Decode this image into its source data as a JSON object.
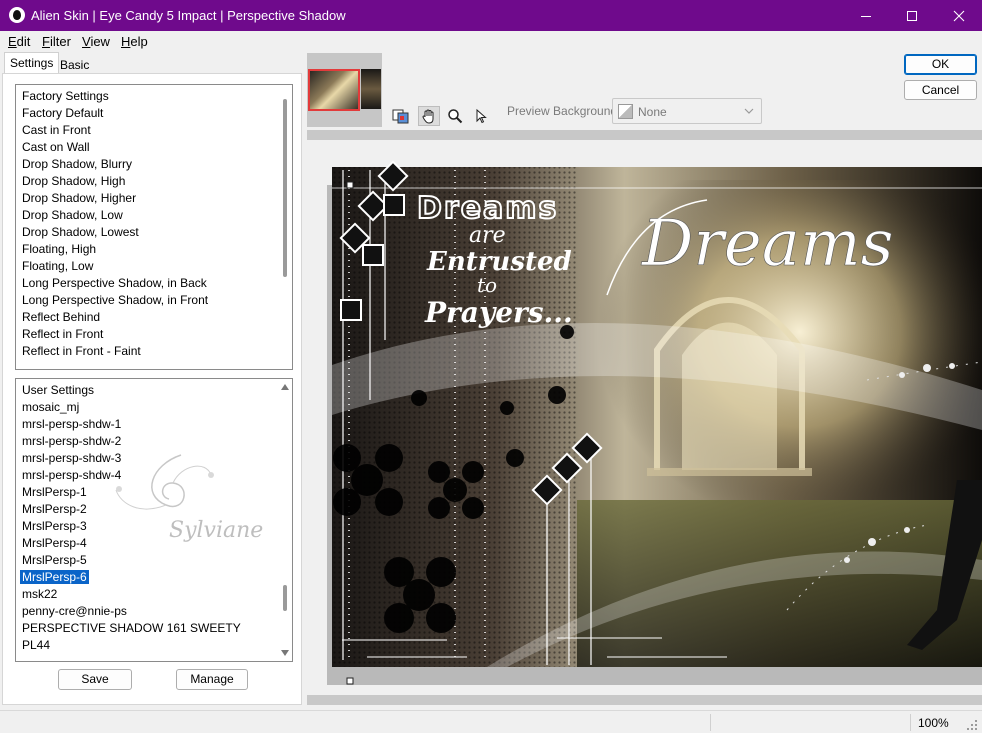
{
  "window": {
    "title": "Alien Skin | Eye Candy 5 Impact | Perspective Shadow"
  },
  "menu": {
    "items": [
      {
        "label": "Edit",
        "accel": "E",
        "rest": "dit"
      },
      {
        "label": "Filter",
        "accel": "F",
        "rest": "ilter"
      },
      {
        "label": "View",
        "accel": "V",
        "rest": "iew"
      },
      {
        "label": "Help",
        "accel": "H",
        "rest": "elp"
      }
    ]
  },
  "tabs": {
    "settings": "Settings",
    "basic": "Basic"
  },
  "factory": {
    "header": "Factory Settings",
    "items": [
      "Factory Default",
      "Cast in Front",
      "Cast on Wall",
      "Drop Shadow, Blurry",
      "Drop Shadow, High",
      "Drop Shadow, Higher",
      "Drop Shadow, Low",
      "Drop Shadow, Lowest",
      "Floating, High",
      "Floating, Low",
      "Long Perspective Shadow, in Back",
      "Long Perspective Shadow, in Front",
      "Reflect Behind",
      "Reflect in Front",
      "Reflect in Front - Faint"
    ]
  },
  "user": {
    "header": "User Settings",
    "items": [
      "mosaic_mj",
      "mrsl-persp-shdw-1",
      "mrsl-persp-shdw-2",
      "mrsl-persp-shdw-3",
      "mrsl-persp-shdw-4",
      "MrslPersp-1",
      "MrslPersp-2",
      "MrslPersp-3",
      "MrslPersp-4",
      "MrslPersp-5",
      "MrslPersp-6",
      "msk22",
      "penny-cre@nnie-ps",
      "PERSPECTIVE SHADOW 161 SWEETY",
      "PL44"
    ],
    "selected": "MrslPersp-6",
    "watermark": "Sylviane"
  },
  "buttons": {
    "save": "Save",
    "manage": "Manage",
    "ok": "OK",
    "cancel": "Cancel"
  },
  "preview": {
    "background_label": "Preview Background:",
    "background_value": "None",
    "text_dreams_block": "Dreams",
    "text_are": "are",
    "text_entrusted": "Entrusted",
    "text_to": "to",
    "text_prayers": "Prayers...",
    "text_script": "Dreams"
  },
  "status": {
    "zoom": "100%"
  },
  "colors": {
    "titlebar": "#6f0a8c",
    "selection": "#0a64c8",
    "thumb_border": "#e23b3b"
  }
}
